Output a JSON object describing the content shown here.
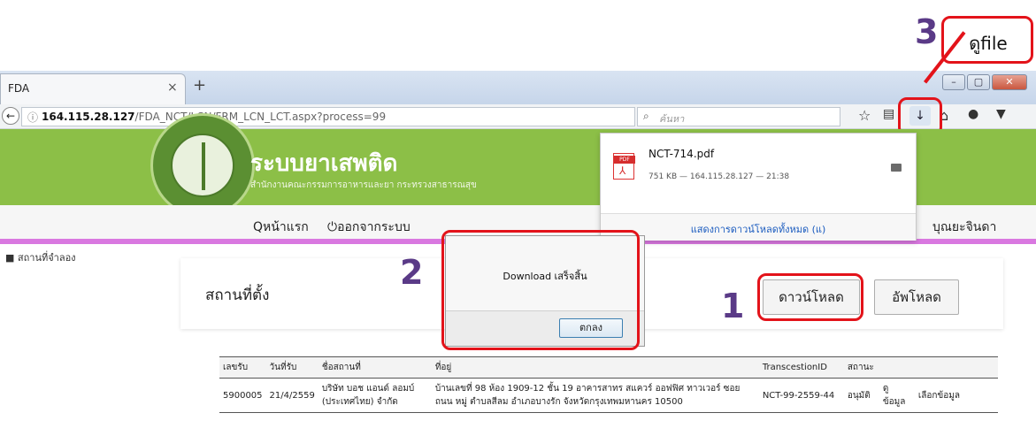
{
  "browser": {
    "tab_title": "FDA",
    "tab_close": "×",
    "new_tab": "+",
    "url_host": "164.115.28.127",
    "url_path": "/FDA_NCT/LCN/FRM_LCN_LCT.aspx?process=99",
    "search_placeholder": "ค้นหา"
  },
  "site": {
    "title": "ระบบยาเสพติด",
    "subtitle": "สำนักงานคณะกรรมการอาหารและยา กระทรวงสาธารณสุข",
    "menu": {
      "home": "หน้าแรก",
      "logout": "ออกจากระบบ",
      "user": "บุณยะจินดา"
    },
    "breadcrumb": "สถานที่จำลอง"
  },
  "download_panel": {
    "file_name": "NCT-714.pdf",
    "file_meta": "751 KB — 164.115.28.127 — 21:38",
    "pdf_badge": "PDF",
    "show_all": "แสดงการดาวน์โหลดทั้งหมด (แ)"
  },
  "content": {
    "title": "สถานที่ตั้ง",
    "download_button": "ดาวน์โหลด",
    "upload_button": "อัพโหลด"
  },
  "dialog": {
    "message": "Download เสร็จสิ้น",
    "ok": "ตกลง"
  },
  "table": {
    "headers": [
      "เลขรับ",
      "วันที่รับ",
      "ชื่อสถานที่",
      "ที่อยู่",
      "TranscestionID",
      "สถานะ",
      "",
      ""
    ],
    "rows": [
      [
        "5900005",
        "21/4/2559",
        "บริษัท บอช แอนด์ ลอมบ์ (ประเทศไทย) จำกัด",
        "บ้านเลขที่ 98 ห้อง 1909-12 ชั้น 19 อาคารสาทร สแควร์ ออฟฟิศ ทาวเวอร์ ซอย ถนน หมู่ ตำบลสีลม อำเภอบางรัก จังหวัดกรุงเทพมหานคร 10500",
        "NCT-99-2559-44",
        "อนุมัติ",
        "ดู ข้อมูล",
        "เลือกข้อมูล"
      ]
    ]
  },
  "annotations": {
    "step1": "1",
    "step2": "2",
    "step3": "3",
    "callout": "ดูfile",
    "accent": "#e3131a"
  }
}
